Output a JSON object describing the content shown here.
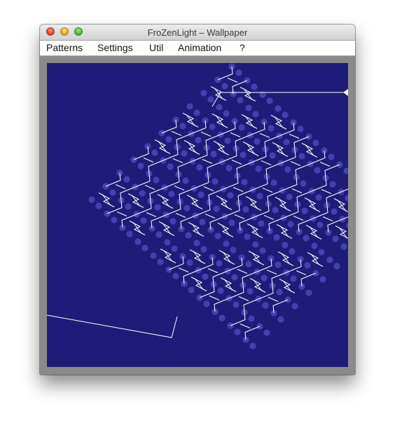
{
  "window": {
    "title": "FroZenLight – Wallpaper"
  },
  "menu": [
    "Patterns",
    "Settings",
    "Util",
    "Animation",
    "?"
  ],
  "canvas": {
    "background": "#1e1c78",
    "dot_color": "#4340b0",
    "line_color": "#ffffff"
  },
  "icons": {
    "close": "close-button",
    "minimize": "minimize-button",
    "zoom": "zoom-button"
  }
}
